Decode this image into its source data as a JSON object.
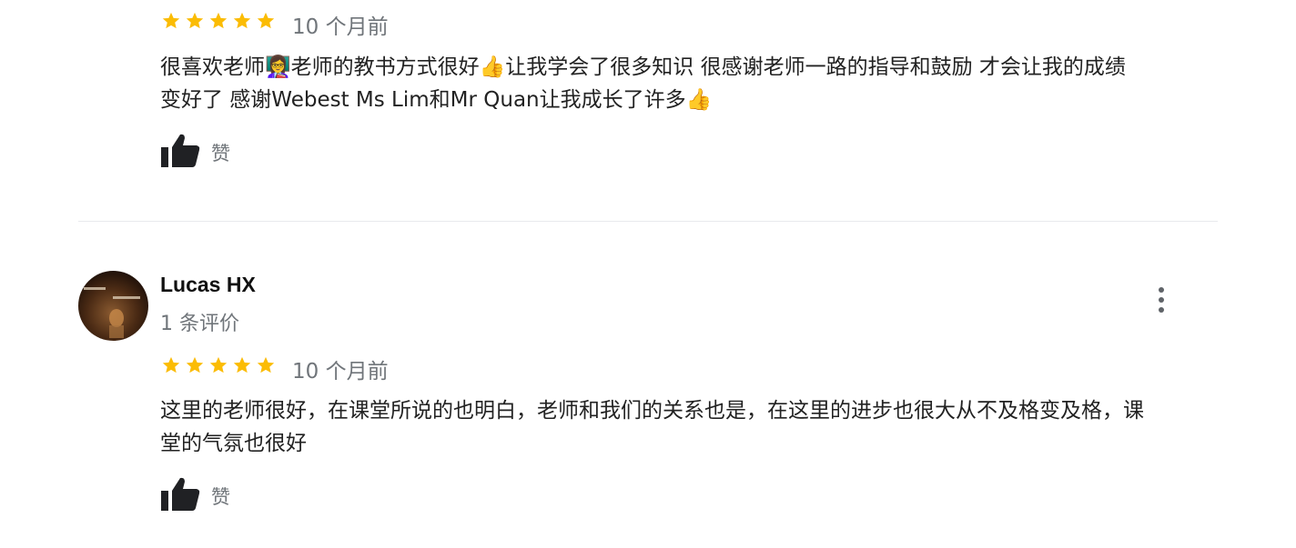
{
  "reviews": [
    {
      "rating": 5,
      "time": "10 个月前",
      "text_line1": "很喜欢老师👩‍🏫老师的教书方式很好👍让我学会了很多知识 很感谢老师一路的指导和鼓励 才会让我的成绩",
      "text_line2": "变好了 感谢Webest Ms Lim和Mr Quan让我成长了许多👍",
      "like_label": "赞"
    },
    {
      "reviewer_name": "Lucas HX",
      "review_count": "1 条评价",
      "rating": 5,
      "time": "10 个月前",
      "text_line1": "这里的老师很好，在课堂所说的也明白，老师和我们的关系也是，在这里的进步也很大从不及格变及格，课",
      "text_line2": "堂的气氛也很好",
      "like_label": "赞"
    }
  ],
  "colors": {
    "star": "#fbbc04",
    "muted": "#70757a",
    "divider": "#e8eaed"
  },
  "icons": [
    "star-icon",
    "thumbs-up-icon",
    "more-vert-icon"
  ]
}
